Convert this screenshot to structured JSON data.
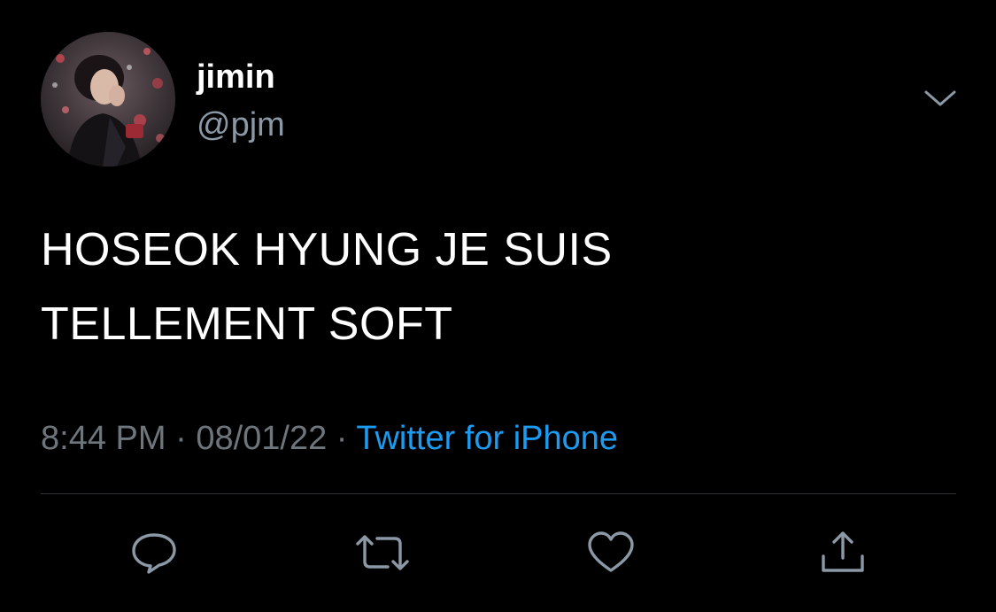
{
  "tweet": {
    "author": {
      "display_name": "jimin",
      "handle": "@pjm"
    },
    "text_line1": "HOSEOK HYUNG JE SUIS",
    "text_line2": "TELLEMENT SOFT",
    "time": "8:44 PM",
    "separator": "·",
    "date": "08/01/22",
    "source": "Twitter for iPhone"
  },
  "icons": {
    "options": "chevron-down-icon",
    "reply": "comment-icon",
    "retweet": "retweet-icon",
    "like": "heart-icon",
    "share": "share-icon"
  },
  "colors": {
    "background": "#000000",
    "primary_text": "#ffffff",
    "secondary_text": "#8b98a5",
    "meta_text": "#6e767d",
    "link": "#1d9bf0",
    "divider": "#2f3336",
    "icon": "#8b98a5"
  }
}
